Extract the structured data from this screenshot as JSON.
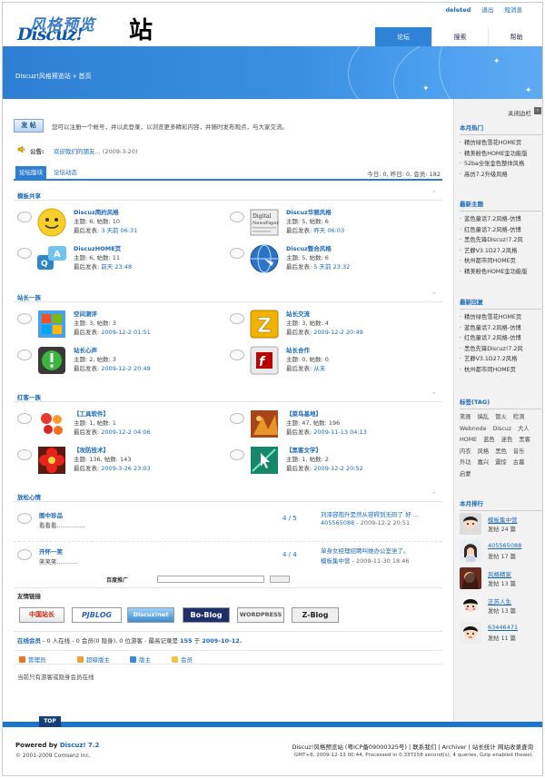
{
  "logo": {
    "line1": "风格预览",
    "line2": "Discuz!",
    "char": "站"
  },
  "toplinks": {
    "user": "deleted",
    "links": [
      "退出",
      "短消息"
    ]
  },
  "tabs": [
    "论坛",
    "搜索",
    "帮助"
  ],
  "breadcrumb": "Discuz!风格预览站 » 首页",
  "notice": {
    "button": "发 帖",
    "text": "您可以注册一个帐号，并以此登录，以浏览更多精彩内容，并随时发布观点，与大家交流。"
  },
  "announcement": {
    "label": "公告:",
    "title": "欢迎我们的朋友...",
    "date": "(2009-3-20)"
  },
  "subnav": {
    "active": "论坛版块",
    "other": "论坛动态",
    "stats": "今日: 0, 昨日: 0, 会员: 182"
  },
  "categories": [
    {
      "name": "模板共享",
      "forums": [
        {
          "name": "Discuz简约风格",
          "stats": "主题: 6, 帖数: 10",
          "last_label": "最后发表:",
          "last": "3 天前 06:31"
        },
        {
          "name": "Discuz华丽风格",
          "stats": "主题: 5, 帖数: 6",
          "last_label": "最后发表:",
          "last": "昨天 06:03"
        },
        {
          "name": "DiscuzHOME页",
          "stats": "主题: 6, 帖数: 11",
          "last_label": "最后发表:",
          "last": "前天 23:48"
        },
        {
          "name": "Discuz整合风格",
          "stats": "主题: 5, 帖数: 6",
          "last_label": "最后发表:",
          "last": "5 天前 23:32"
        }
      ]
    },
    {
      "name": "站长一族",
      "forums": [
        {
          "name": "空间测评",
          "stats": "主题: 3, 帖数: 3",
          "last_label": "最后发表:",
          "last": "2009-12-2 01:51"
        },
        {
          "name": "站长交流",
          "stats": "主题: 3, 帖数: 4",
          "last_label": "最后发表:",
          "last": "2009-12-2 20:49"
        },
        {
          "name": "站长心声",
          "stats": "主题: 2, 帖数: 3",
          "last_label": "最后发表:",
          "last": "2009-12-2 20:49"
        },
        {
          "name": "站长合作",
          "stats": "主题: 0, 帖数: 0",
          "last_label": "最后发表:",
          "last": "从未"
        }
      ]
    },
    {
      "name": "红客一族",
      "forums": [
        {
          "name": "【工具软件】",
          "stats": "主题: 1, 帖数: 1",
          "last_label": "最后发表:",
          "last": "2009-12-2 04:06"
        },
        {
          "name": "【菜鸟基地】",
          "stats": "主题: 47, 帖数: 196",
          "last_label": "最后发表:",
          "last": "2009-11-13 04:13"
        },
        {
          "name": "【攻防技术】",
          "stats": "主题: 136, 帖数: 143",
          "last_label": "最后发表:",
          "last": "2009-3-26 23:03"
        },
        {
          "name": "【黑客文学】",
          "stats": "主题: 1, 帖数: 2",
          "last_label": "最后发表:",
          "last": "2009-12-2 20:52"
        }
      ]
    }
  ],
  "relax": {
    "name": "放松心情",
    "rows": [
      {
        "name": "图中珍品",
        "mod": "看看看...............",
        "count": "4 / 5",
        "last_title": "刘泽容抱升是然从容碍到无码了 好 ...",
        "last_author": "405565088",
        "last_date": "- 2009-12-2 20:51"
      },
      {
        "name": "开怀一笑",
        "mod": "笑笑笑...........",
        "count": "4 / 4",
        "last_title": "单身女经理招聘叫她办公室坐了。",
        "last_author": "模板集中营",
        "last_date": "- 2009-11-30 18:46"
      }
    ]
  },
  "ad": {
    "label": "百度推广"
  },
  "links": {
    "title": "友情链接",
    "logos": [
      "中国站长",
      "PJBLOG",
      "Discuz!net",
      "Bo-Blog",
      "WORDPRESS",
      "Z-Blog"
    ]
  },
  "online": {
    "title": "在线会员",
    "text": " - 0 人在线 - 0 会员(0 隐身), 0 位游客 - 最高记录是 ",
    "record": "155",
    "record_sep": " 于 ",
    "record_date": "2009-10-12.",
    "legend": [
      "管理员",
      "超级版主",
      "版主",
      "会员"
    ],
    "none": "当前只有游客或隐身会员在线"
  },
  "side": {
    "close": "关闭边栏",
    "hot": {
      "title": "本月热门",
      "items": [
        "精仿绿色雪花HOME页",
        "精美粉色HOME金功能版",
        "52ba全张金色整体风格",
        "高仿7.2升级风格"
      ]
    },
    "new": {
      "title": "最新主题",
      "items": [
        "蓝色童话7.2风格-仿博",
        "红色童话7.2风格-仿博",
        "黑色先锋Discuz!7.2风",
        "艺静V3.1D27.2风格",
        "杭州都市同HOME页",
        "精美粉色HOME金功能版"
      ]
    },
    "reply": {
      "title": "最新回复",
      "items": [
        "精仿绿色雪花HOME页",
        "蓝色童话7.2风格-仿博",
        "红色童话7.2风格-仿博",
        "黑色先锋Discuz!7.2风",
        "艺静V3.1D27.2风格",
        "杭州都市同HOME页"
      ]
    },
    "tags": {
      "title": "标签(TAG)",
      "items": [
        "笑画",
        "搞乱",
        "管火",
        "检测",
        "Webnode",
        "Discuz",
        "大人",
        "HOME",
        "蓝色",
        "迷色",
        "黑客",
        "内衣",
        "风格",
        "黑色",
        "音乐",
        "外功",
        "嘉兴",
        "震惊",
        "古墓",
        "启蒙"
      ]
    },
    "rank": {
      "title": "本月排行",
      "items": [
        {
          "name": "模板集中营",
          "posts": "发帖 24 篇"
        },
        {
          "name": "405565088",
          "posts": "发帖 17 篇"
        },
        {
          "name": "风格精家",
          "posts": "发帖 13 篇"
        },
        {
          "name": "正苏人生",
          "posts": "发帖 13 篇"
        },
        {
          "name": "63446471",
          "posts": "发帖 11 篇"
        }
      ]
    }
  },
  "footer": {
    "top": "TOP",
    "powered_prefix": "Powered by ",
    "powered_product": "Discuz! 7.2",
    "copyright": "© 2001-2009 Comsenz Inc.",
    "right_line1": "Discuz!风格预览站 (粤ICP备09000325号) | 联系我们 | Archiver | 站长统计 网站收录查询",
    "right_line2": "GMT+8, 2009-12-13 00:44, Processed in 0.337258 second(s), 4 queries, Gzip enabled thewei."
  }
}
